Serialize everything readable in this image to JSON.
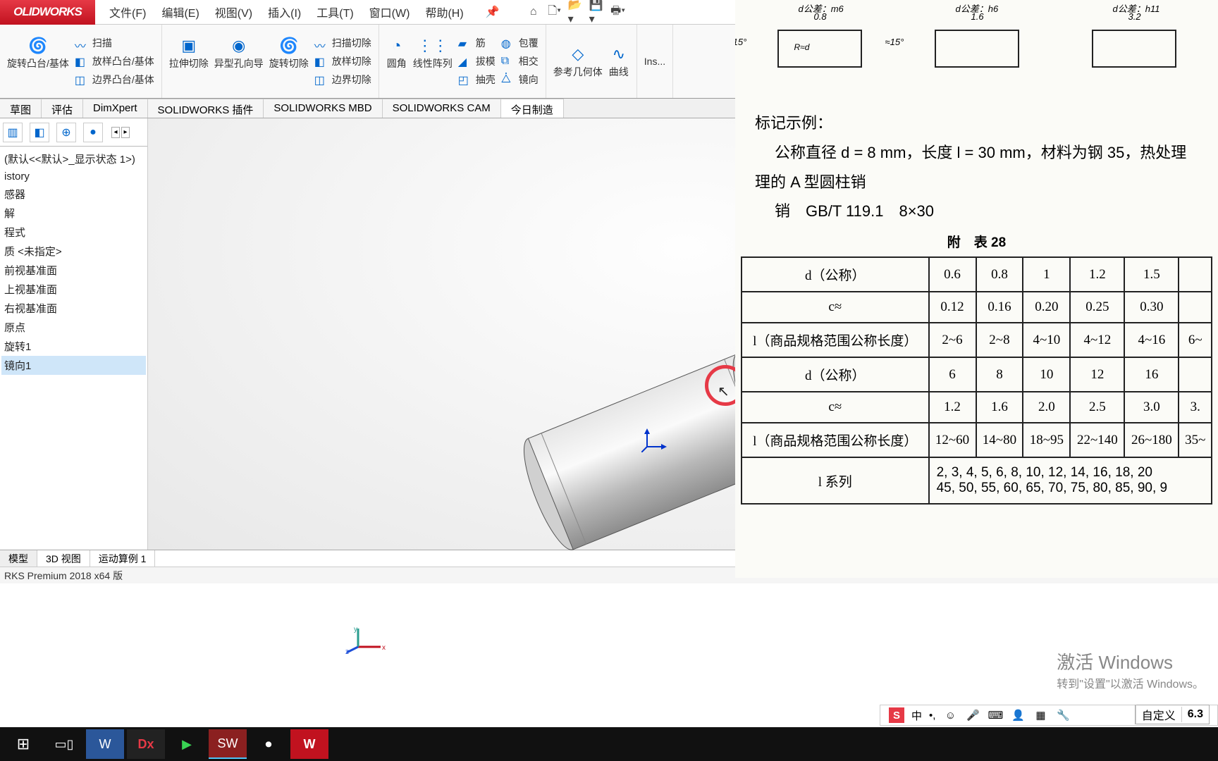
{
  "app": {
    "logo": "OLIDWORKS"
  },
  "menu": {
    "file": "文件(F)",
    "edit": "编辑(E)",
    "view": "视图(V)",
    "insert": "插入(I)",
    "tools": "工具(T)",
    "window": "窗口(W)",
    "help": "帮助(H)"
  },
  "ribbon": {
    "revolve": "旋转凸台/基体",
    "sweep": "扫描",
    "loft": "放样凸台/基体",
    "boundary": "边界凸台/基体",
    "extrude_cut": "拉伸切除",
    "hole_wizard": "异型孔向导",
    "revolve_cut": "旋转切除",
    "sweep_cut": "扫描切除",
    "loft_cut": "放样切除",
    "boundary_cut": "边界切除",
    "fillet": "圆角",
    "linear_pattern": "线性阵列",
    "rib": "筋",
    "draft": "拔模",
    "shell": "抽壳",
    "wrap": "包覆",
    "intersect": "相交",
    "mirror": "镜向",
    "ref_geom": "参考几何体",
    "curves": "曲线",
    "instant": "Ins..."
  },
  "tabs": {
    "sketch": "草图",
    "evaluate": "评估",
    "dimxpert": "DimXpert",
    "plugins": "SOLIDWORKS 插件",
    "mbd": "SOLIDWORKS MBD",
    "cam": "SOLIDWORKS CAM",
    "today": "今日制造"
  },
  "tree": {
    "config": "(默认<<默认>_显示状态 1>)",
    "items": [
      "istory",
      "感器",
      "解",
      "程式",
      "质 <未指定>",
      "前视基准面",
      "上视基准面",
      "右视基准面",
      "原点",
      "旋转1",
      "镜向1"
    ]
  },
  "bottom_tabs": {
    "model": "模型",
    "view3d": "3D 视图",
    "motion": "运动算例 1"
  },
  "status": "RKS Premium 2018 x64 版",
  "watermark": {
    "l1": "激活 Windows",
    "l2": "转到\"设置\"以激活 Windows。"
  },
  "ime": {
    "custom_label": "自定义",
    "custom_val": "6.3",
    "cn": "中"
  },
  "ref": {
    "fig_top": {
      "a": "d公差：m6",
      "a2": "0.8",
      "b": "d公差：h6",
      "b2": "1.6",
      "c": "d公差：h11",
      "c2": "3.2"
    },
    "angle": "≈15°",
    "heading": "标记示例：",
    "line1": "公称直径 d = 8 mm，长度 l = 30 mm，材料为钢 35，热处理",
    "line2": "理的 A 型圆柱销",
    "line3": "销　GB/T 119.1　8×30",
    "table_title": "附　表 28",
    "rows": {
      "d_label": "d（公称）",
      "c_label": "c≈",
      "l_label": "l（商品规格范围公称长度）",
      "series_label": "l 系列",
      "d1": [
        "0.6",
        "0.8",
        "1",
        "1.2",
        "1.5"
      ],
      "c1": [
        "0.12",
        "0.16",
        "0.20",
        "0.25",
        "0.30"
      ],
      "l1": [
        "2~6",
        "2~8",
        "4~10",
        "4~12",
        "4~16",
        "6~"
      ],
      "d2": [
        "6",
        "8",
        "10",
        "12",
        "16"
      ],
      "c2": [
        "1.2",
        "1.6",
        "2.0",
        "2.5",
        "3.0",
        "3."
      ],
      "l2": [
        "12~60",
        "14~80",
        "18~95",
        "22~140",
        "26~180",
        "35~"
      ],
      "series1": "2, 3, 4, 5, 6, 8, 10, 12, 14, 16, 18, 20",
      "series2": "45, 50, 55, 60, 65, 70, 75, 80, 85, 90, 9"
    }
  }
}
